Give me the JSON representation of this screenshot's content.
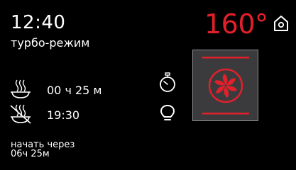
{
  "status": {
    "time": "12:40",
    "mode": "турбо-режим",
    "temperature": "160°"
  },
  "program": {
    "duration": "00 ч 25 м",
    "end_time": "19:30"
  },
  "delayed_start": {
    "label": "начать через",
    "value": "06ч 25м"
  },
  "icons": {
    "home": "home-icon",
    "duration": "cooking-pot-icon",
    "end": "end-time-disabled-icon",
    "timer": "stopwatch-icon",
    "lamp": "light-bulb-icon",
    "fan": "turbo-fan-icon"
  },
  "colors": {
    "accent": "#e2202b",
    "background": "#000000",
    "panel": "#3b3b3d",
    "text": "#ffffff"
  }
}
